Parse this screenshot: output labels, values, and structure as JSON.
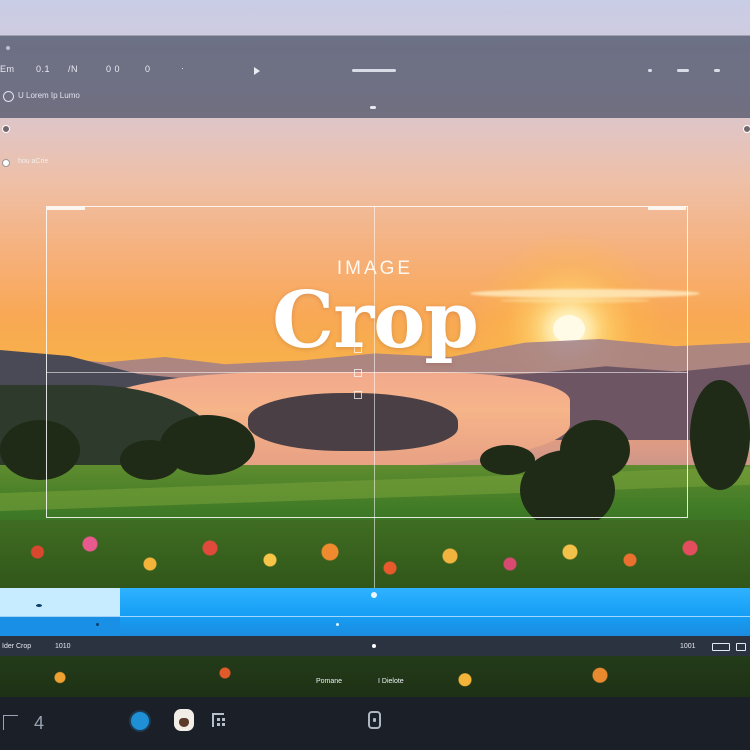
{
  "toolbar": {
    "menu_items": [
      "Em",
      "0.1",
      "/N",
      "0 0",
      "0"
    ],
    "row2_label": "U Lorem Ip Lumo"
  },
  "side_panel": {
    "option_label": "hou aCrie"
  },
  "canvas": {
    "title_small": "IMAGE",
    "title_big": "Crop"
  },
  "statusbar": {
    "left_label": "Ider Crop",
    "left_value": "1010",
    "right_label": "1001"
  },
  "captions": {
    "left": "Pomane",
    "right": "I Dielote"
  },
  "dock": {
    "glyph_left": "4"
  },
  "colors": {
    "timeline_accent": "#159ff5",
    "dock_dot": "#1f8fd6",
    "toolbar_bg": "#464e62"
  }
}
